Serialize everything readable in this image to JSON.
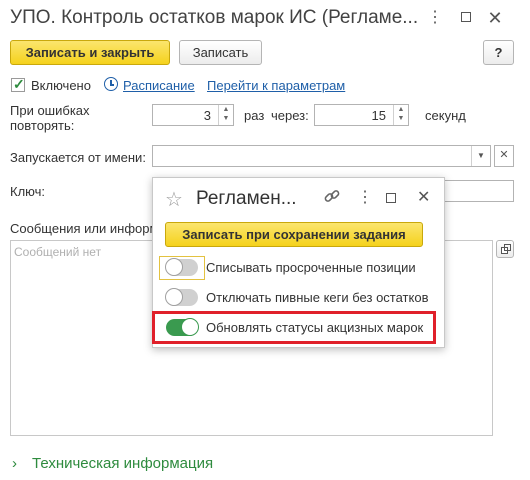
{
  "window": {
    "title": "УПО. Контроль остатков марок ИС (Регламе...",
    "more_icon": "more-vertical-icon",
    "maximize_icon": "maximize-icon",
    "close_icon": "close-icon"
  },
  "toolbar": {
    "save_close_label": "Записать и закрыть",
    "save_label": "Записать",
    "help_label": "?"
  },
  "schedule": {
    "enabled_label": "Включено",
    "enabled_checked": true,
    "schedule_link": "Расписание",
    "params_link": "Перейти к параметрам"
  },
  "retry": {
    "label": "При ошибках повторять:",
    "count": "3",
    "times_label": "раз",
    "through_label": "через:",
    "seconds_value": "15",
    "seconds_label": "секунд"
  },
  "run_as": {
    "label": "Запускается от имени:",
    "value": ""
  },
  "key": {
    "label": "Ключ:",
    "value": ""
  },
  "messages": {
    "label": "Сообщения или информ",
    "placeholder": "Сообщений нет"
  },
  "tech_info": {
    "label": "Техническая информация"
  },
  "popup": {
    "title": "Регламен...",
    "save_on_task_label": "Записать при сохранении задания",
    "options": [
      {
        "label": "Списывать просроченные позиции",
        "on": false
      },
      {
        "label": "Отключать пивные кеги без остатков",
        "on": false
      },
      {
        "label": "Обновлять статусы акцизных марок",
        "on": true
      }
    ],
    "highlight_color": "#e0202a",
    "toggle_on_color": "#3a9a4f"
  }
}
